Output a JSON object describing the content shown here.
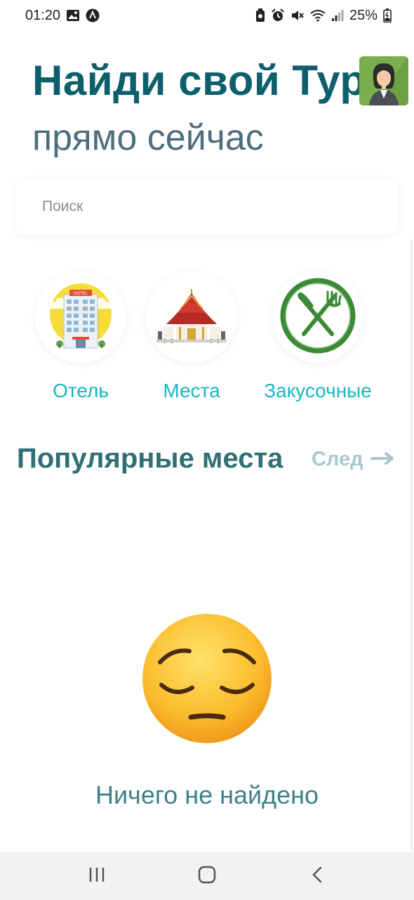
{
  "status_bar": {
    "time": "01:20",
    "battery": "25%",
    "icons": [
      "gallery-icon",
      "app-notification-icon",
      "battery-saver-icon",
      "alarm-icon",
      "mute-icon",
      "wifi-icon",
      "signal-icon",
      "battery-icon"
    ]
  },
  "header": {
    "title": "Найди свой Тур",
    "subtitle": "прямо сейчас",
    "avatar_icon": "user-avatar"
  },
  "search": {
    "placeholder": "Поиск",
    "value": ""
  },
  "categories": [
    {
      "label": "Отель",
      "icon": "hotel-icon"
    },
    {
      "label": "Места",
      "icon": "temple-icon"
    },
    {
      "label": "Закусочные",
      "icon": "fork-knife-icon"
    }
  ],
  "popular": {
    "title": "Популярные места",
    "next_label": "След",
    "next_icon": "arrow-right-icon"
  },
  "empty_state": {
    "icon": "pensive-face-icon",
    "message": "Ничего не найдено"
  },
  "nav": {
    "recent_icon": "recent-apps-icon",
    "home_icon": "home-icon",
    "back_icon": "back-icon"
  },
  "colors": {
    "title": "#0d5f6b",
    "subtitle": "#4f6e7b",
    "category_label": "#18b6c2",
    "section_title": "#2f6f76",
    "next_link": "#a8c8cf",
    "empty_text": "#3f8088"
  }
}
